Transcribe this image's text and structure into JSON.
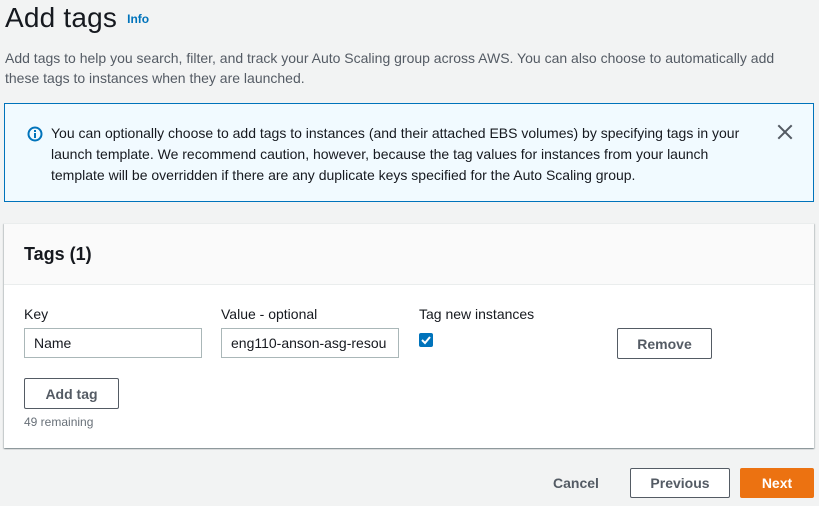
{
  "page": {
    "title": "Add tags",
    "info_label": "Info",
    "description": "Add tags to help you search, filter, and track your Auto Scaling group across AWS. You can also choose to automatically add these tags to instances when they are launched."
  },
  "alert": {
    "icon": "info-circle-icon",
    "text": "You can optionally choose to add tags to instances (and their attached EBS volumes) by specifying tags in your launch template. We recommend caution, however, because the tag values for instances from your launch template will be overridden if there are any duplicate keys specified for the Auto Scaling group.",
    "close_icon": "close-icon",
    "border_color": "#0073bb",
    "background_color": "#f1faff"
  },
  "tags_panel": {
    "title": "Tags (1)",
    "columns": {
      "key": "Key",
      "value": "Value - optional",
      "tag_new_instances": "Tag new instances"
    },
    "rows": [
      {
        "key": "Name",
        "value": "eng110-anson-asg-resou",
        "tag_new_instances": true,
        "remove_label": "Remove"
      }
    ],
    "add_tag_label": "Add tag",
    "remaining_text": "49 remaining"
  },
  "footer": {
    "cancel_label": "Cancel",
    "previous_label": "Previous",
    "next_label": "Next",
    "primary_color": "#ec7211"
  }
}
